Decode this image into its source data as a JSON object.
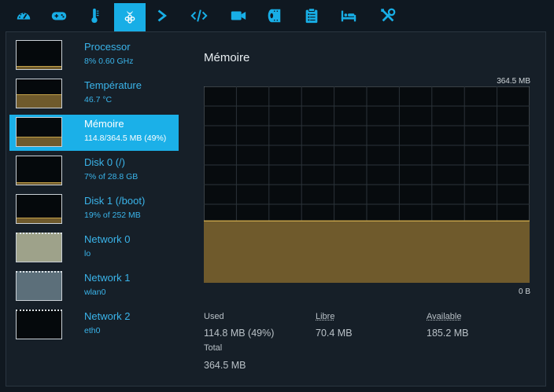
{
  "toolbar": {
    "tabs": [
      {
        "icon": "dashboard-icon"
      },
      {
        "icon": "gamepad-icon"
      },
      {
        "icon": "thermometer-icon"
      },
      {
        "icon": "raspberry-icon",
        "active": true
      },
      {
        "icon": "terminal-icon"
      },
      {
        "icon": "code-icon"
      },
      {
        "icon": "video-camera-icon"
      },
      {
        "icon": "film-roll-icon"
      },
      {
        "icon": "clipboard-list-icon"
      },
      {
        "icon": "bed-icon"
      },
      {
        "icon": "tools-icon"
      }
    ],
    "accent": "#18aee6"
  },
  "sidebar": {
    "items": [
      {
        "name": "Processor",
        "sub": "8% 0.60 GHz",
        "level": 0.08
      },
      {
        "name": "Température",
        "sub": "46.7 °C",
        "level": 0.47
      },
      {
        "name": "Mémoire",
        "sub": "114.8/364.5 MB (49%)",
        "level": 0.31,
        "selected": true
      },
      {
        "name": "Disk 0 (/)",
        "sub": "7% of 28.8 GB",
        "level": 0.07
      },
      {
        "name": "Disk 1 (/boot)",
        "sub": "19% of 252 MB",
        "level": 0.19
      },
      {
        "name": "Network 0",
        "sub": "lo"
      },
      {
        "name": "Network 1",
        "sub": "wlan0"
      },
      {
        "name": "Network 2",
        "sub": "eth0"
      }
    ]
  },
  "detail": {
    "title": "Mémoire",
    "chart_max_label": "364.5 MB",
    "chart_min_label": "0 B",
    "stats": {
      "used_label": "Used",
      "used_value": "114.8 MB (49%)",
      "libre_label": "Libre",
      "libre_value": "70.4 MB",
      "available_label": "Available",
      "available_value": "185.2 MB",
      "total_label": "Total",
      "total_value": "364.5 MB"
    }
  },
  "chart_data": {
    "type": "area",
    "ylim": [
      0,
      364.5
    ],
    "y_unit": "MB",
    "grid": true,
    "series": [
      {
        "values": [
          114.8,
          114.8,
          114.8,
          114.8,
          114.8,
          114.8,
          114.8,
          114.8,
          114.8,
          114.8,
          114.8,
          114.8,
          114.8,
          114.8,
          114.8,
          114.8,
          114.8,
          114.8,
          114.8,
          114.8,
          114.8
        ]
      }
    ],
    "colors": {
      "fill": "#6f5a2c",
      "line": "#c4a24a",
      "grid": "#2b3339",
      "background": "#070b0e"
    }
  }
}
